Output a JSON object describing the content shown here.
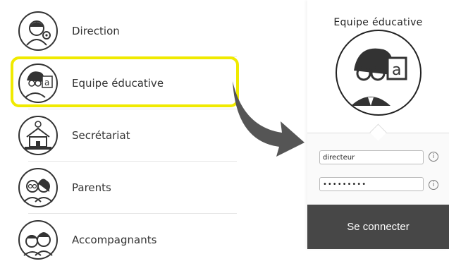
{
  "roles": [
    {
      "label": "Direction",
      "icon": "director-avatar-icon"
    },
    {
      "label": "Equipe éducative",
      "icon": "teacher-avatar-icon"
    },
    {
      "label": "Secrétariat",
      "icon": "school-building-icon"
    },
    {
      "label": "Parents",
      "icon": "parents-avatar-icon"
    },
    {
      "label": "Accompagnants",
      "icon": "companions-avatar-icon"
    }
  ],
  "login": {
    "title": "Equipe éducative",
    "username": "directeur",
    "password": "•••••••••",
    "button_label": "Se connecter",
    "info_glyph": "i"
  },
  "colors": {
    "highlight": "#f0ea00",
    "button_bg": "#474747",
    "arrow": "#555555"
  }
}
